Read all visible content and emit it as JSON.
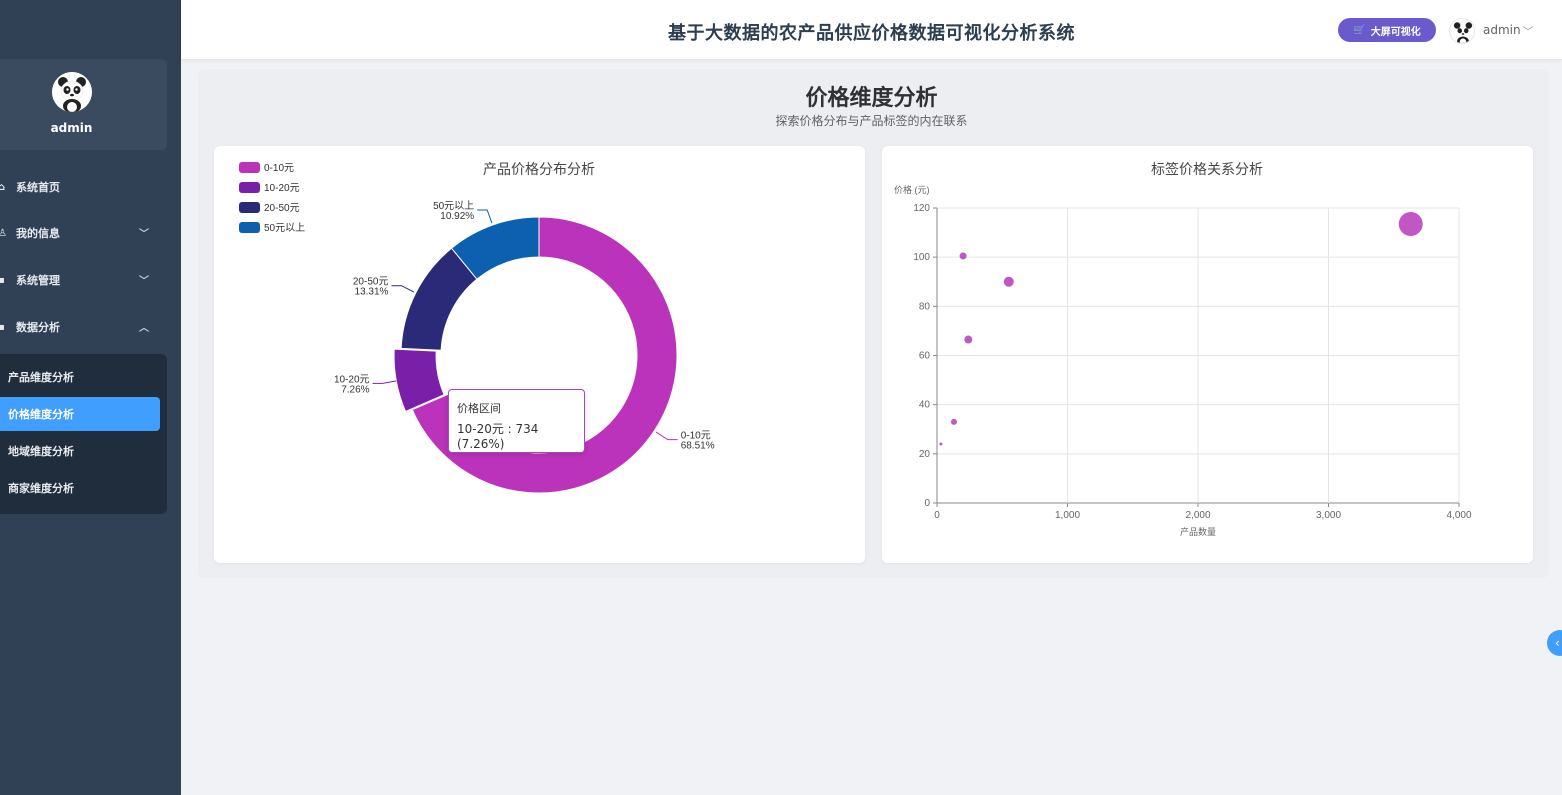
{
  "sidebar": {
    "username": "admin",
    "menu": [
      {
        "label": "系统首页",
        "icon": "home-icon"
      },
      {
        "label": "我的信息",
        "icon": "user-icon"
      },
      {
        "label": "系统管理",
        "icon": "grid-icon"
      },
      {
        "label": "数据分析",
        "icon": "grid-icon"
      }
    ],
    "submenu": [
      {
        "label": "产品维度分析",
        "active": false
      },
      {
        "label": "价格维度分析",
        "active": true
      },
      {
        "label": "地域维度分析",
        "active": false
      },
      {
        "label": "商家维度分析",
        "active": false
      }
    ]
  },
  "header": {
    "title": "基于大数据的农产品供应价格数据可视化分析系统",
    "bigscreen_label": "大屏可视化",
    "username": "admin"
  },
  "main": {
    "title": "价格维度分析",
    "subtitle": "探索价格分布与产品标签的内在联系"
  },
  "colors": {
    "sidebar_bg": "#304156",
    "active": "#409eff",
    "bigscreen": "#6a5acd"
  },
  "chart_data": [
    {
      "type": "pie",
      "title": "产品价格分布分析",
      "donut": true,
      "legend_position": "top-left",
      "slices": [
        {
          "name": "0-10元",
          "percent": 68.51,
          "label": "68.51%",
          "color": "#bb33bb"
        },
        {
          "name": "10-20元",
          "percent": 7.26,
          "label": "7.26%",
          "color": "#7a1fa8"
        },
        {
          "name": "20-50元",
          "percent": 13.31,
          "label": "13.31%",
          "color": "#2b2a78"
        },
        {
          "name": "50元以上",
          "percent": 10.92,
          "label": "10.92%",
          "color": "#0d5fb0"
        }
      ],
      "tooltip": {
        "title": "价格区间",
        "text": "10-20元 : 734 (7.26%)"
      }
    },
    {
      "type": "scatter",
      "title": "标签价格关系分析",
      "xlabel": "产品数量",
      "ylabel": "价格 (元)",
      "xlim": [
        0,
        4000
      ],
      "ylim": [
        0,
        120
      ],
      "xticks": [
        0,
        1000,
        2000,
        3000,
        4000
      ],
      "xtick_labels": [
        "0",
        "1,000",
        "2,000",
        "3,000",
        "4,000"
      ],
      "yticks": [
        0,
        20,
        40,
        60,
        80,
        100,
        120
      ],
      "grid": true,
      "color": "#bb44bb",
      "points": [
        {
          "x": 30,
          "y": 24,
          "size": 1.5
        },
        {
          "x": 130,
          "y": 33,
          "size": 3
        },
        {
          "x": 200,
          "y": 100.5,
          "size": 3.5
        },
        {
          "x": 240,
          "y": 66.5,
          "size": 4
        },
        {
          "x": 550,
          "y": 90,
          "size": 5
        },
        {
          "x": 3630,
          "y": 113.5,
          "size": 12
        }
      ]
    }
  ]
}
